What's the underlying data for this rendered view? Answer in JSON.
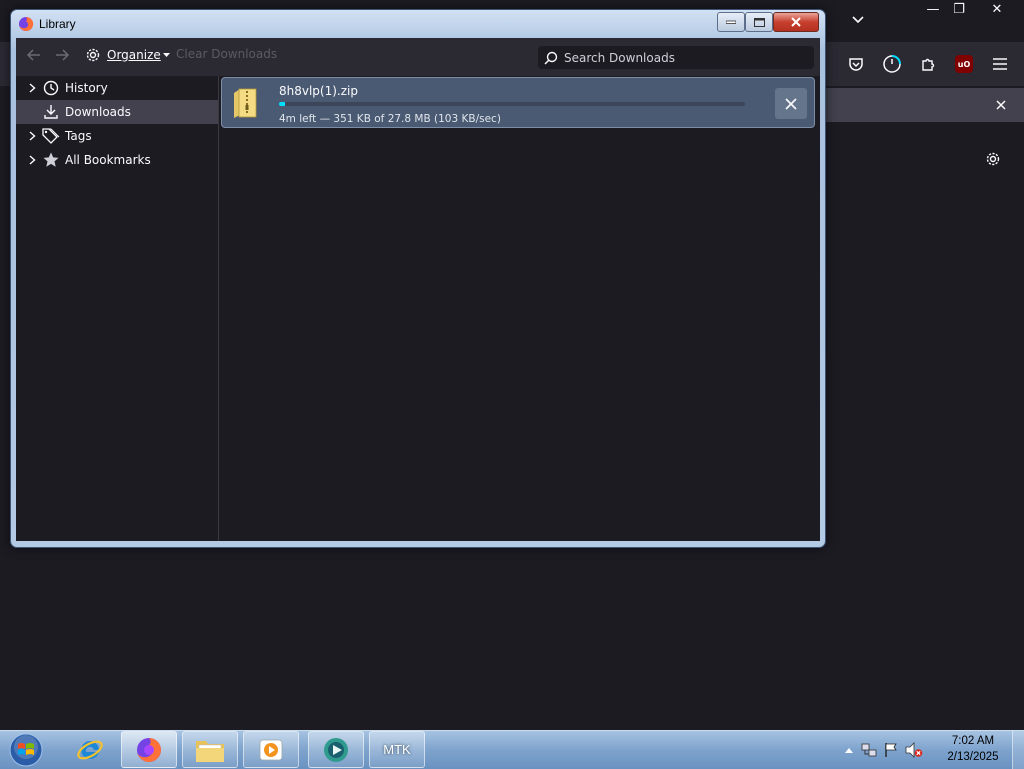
{
  "browser": {
    "window_controls": {
      "minimize": "—",
      "maximize": "❐",
      "close": "✕"
    }
  },
  "library": {
    "title": "Library",
    "toolbar": {
      "organize_label": "Organize",
      "clear_downloads_label": "Clear Downloads",
      "search_placeholder": "Search Downloads"
    },
    "sidebar": {
      "items": [
        {
          "label": "History",
          "icon": "clock-icon",
          "expandable": true,
          "selected": false
        },
        {
          "label": "Downloads",
          "icon": "download-icon",
          "expandable": false,
          "selected": true
        },
        {
          "label": "Tags",
          "icon": "tag-icon",
          "expandable": true,
          "selected": false
        },
        {
          "label": "All Bookmarks",
          "icon": "star-icon",
          "expandable": true,
          "selected": false
        }
      ]
    },
    "downloads": [
      {
        "filename": "8h8vlp(1).zip",
        "status": "4m left — 351 KB of 27.8 MB (103 KB/sec)",
        "progress_percent": 1.2,
        "icon": "zip-folder-icon"
      }
    ]
  },
  "taskbar": {
    "buttons": [
      {
        "name": "internet-explorer",
        "icon": "ie-icon"
      },
      {
        "name": "firefox",
        "icon": "firefox-icon"
      },
      {
        "name": "file-explorer",
        "icon": "folder-icon"
      },
      {
        "name": "media-player",
        "icon": "media-player-icon"
      },
      {
        "name": "app",
        "icon": "app-icon"
      },
      {
        "name": "mtk",
        "label": "MTK"
      }
    ],
    "clock": {
      "time": "7:02 AM",
      "date": "2/13/2025"
    }
  },
  "colors": {
    "accent": "#00ddff",
    "window_frame": "#a8c1df",
    "dark_bg": "#1c1b22",
    "toolbar_bg": "#2b2a33"
  }
}
